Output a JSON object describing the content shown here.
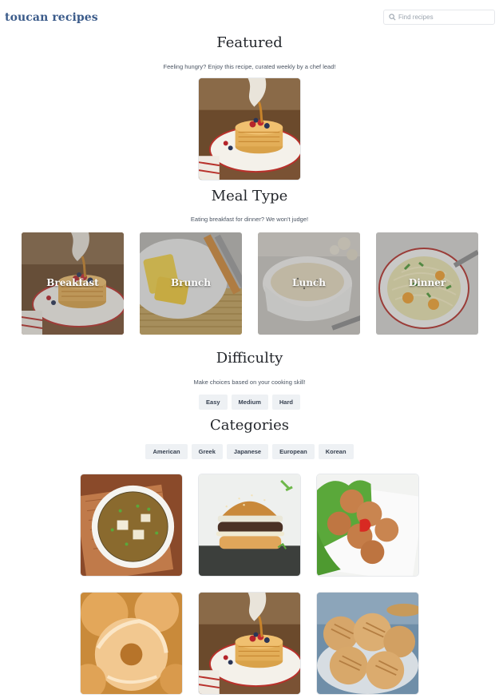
{
  "header": {
    "brand": "toucan recipes",
    "search_placeholder": "Find recipes"
  },
  "featured": {
    "title": "Featured",
    "subtitle": "Feeling hungry? Enjoy this recipe, curated weekly by a chef lead!",
    "image": "pancakes"
  },
  "meal_type": {
    "title": "Meal Type",
    "subtitle": "Eating breakfast for dinner? We won't judge!",
    "items": [
      {
        "label": "Breakfast",
        "image": "pancakes"
      },
      {
        "label": "Brunch",
        "image": "omelette"
      },
      {
        "label": "Lunch",
        "image": "soup-bowl"
      },
      {
        "label": "Dinner",
        "image": "noodle-soup"
      }
    ]
  },
  "difficulty": {
    "title": "Difficulty",
    "subtitle": "Make choices based on your cooking skill!",
    "options": [
      "Easy",
      "Medium",
      "Hard"
    ]
  },
  "categories": {
    "title": "Categories",
    "options": [
      "American",
      "Greek",
      "Japanese",
      "European",
      "Korean"
    ],
    "recipes": [
      {
        "image": "miso-soup"
      },
      {
        "image": "burger"
      },
      {
        "image": "fritters"
      },
      {
        "image": "donuts"
      },
      {
        "image": "pancakes"
      },
      {
        "image": "peanut-cookies"
      }
    ]
  },
  "colors": {
    "brand": "#3b5b8a",
    "chip_bg": "#eef1f4"
  }
}
